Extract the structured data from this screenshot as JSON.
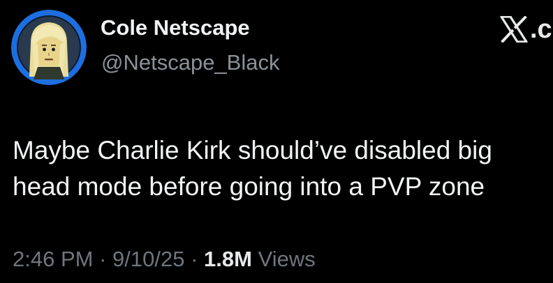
{
  "tweet": {
    "author": {
      "display_name": "Cole Netscape",
      "handle": "@Netscape_Black",
      "avatar_icon": "lego-minifigure-avatar"
    },
    "brand": {
      "icon": "x-logo-icon",
      "suffix": ".c"
    },
    "text_lines": [
      "Maybe Charlie Kirk should’ve disabled big",
      "head mode before going into a PVP zone"
    ],
    "meta": {
      "time": "2:46 PM",
      "separator": "·",
      "date": "9/10/25",
      "views_count": "1.8M",
      "views_label": "Views"
    }
  },
  "colors": {
    "background": "#000000",
    "primary_text": "#e7e9ea",
    "secondary_text": "#8b9298",
    "avatar_ring": "#1d6fe0"
  }
}
